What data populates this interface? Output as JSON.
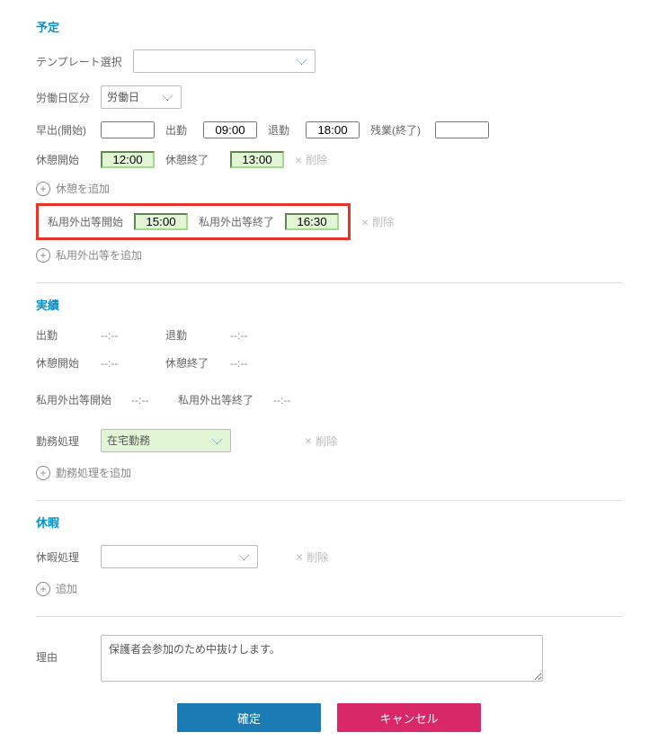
{
  "plan": {
    "title": "予定",
    "template_label": "テンプレート選択",
    "template_value": "",
    "workday_label": "労働日区分",
    "workday_value": "労働日",
    "early_label": "早出(開始)",
    "early_value": "",
    "attend_label": "出勤",
    "attend_value": "09:00",
    "leave_label": "退勤",
    "leave_value": "18:00",
    "ot_label": "残業(終了)",
    "ot_value": "",
    "break_start_label": "休憩開始",
    "break_start_value": "12:00",
    "break_end_label": "休憩終了",
    "break_end_value": "13:00",
    "delete_label": "削除",
    "add_break_label": "休憩を追加",
    "priv_start_label": "私用外出等開始",
    "priv_start_value": "15:00",
    "priv_end_label": "私用外出等終了",
    "priv_end_value": "16:30",
    "add_priv_label": "私用外出等を追加"
  },
  "actual": {
    "title": "実績",
    "attend_label": "出勤",
    "attend_value": "--:--",
    "leave_label": "退勤",
    "leave_value": "--:--",
    "break_start_label": "休憩開始",
    "break_start_value": "--:--",
    "break_end_label": "休憩終了",
    "break_end_value": "--:--",
    "priv_start_label": "私用外出等開始",
    "priv_start_value": "--:--",
    "priv_end_label": "私用外出等終了",
    "priv_end_value": "--:--",
    "worktype_label": "勤務処理",
    "worktype_value": "在宅勤務",
    "delete_label": "削除",
    "add_worktype_label": "勤務処理を追加"
  },
  "vacation": {
    "title": "休暇",
    "select_label": "休暇処理",
    "select_value": "",
    "delete_label": "削除",
    "add_label": "追加"
  },
  "reason": {
    "label": "理由",
    "value": "保護者会参加のため中抜けします。"
  },
  "buttons": {
    "confirm": "確定",
    "cancel": "キャンセル"
  }
}
